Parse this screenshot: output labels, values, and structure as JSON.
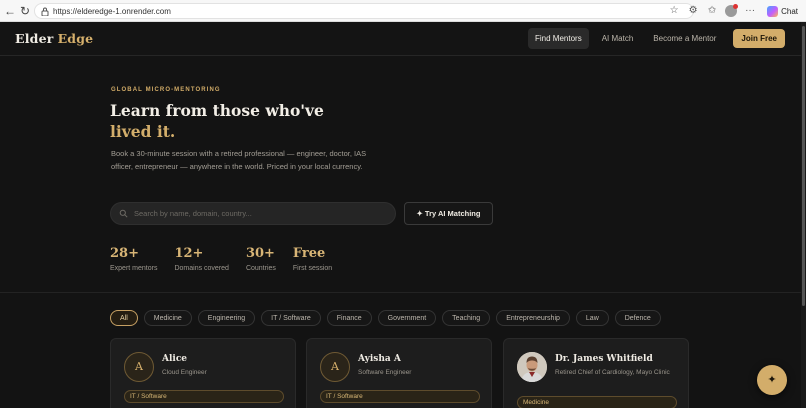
{
  "browser": {
    "url": "https://elderedge-1.onrender.com",
    "chat_label": "Chat"
  },
  "header": {
    "logo_word1": "Elder",
    "logo_word2": "Edge",
    "nav": [
      "Find Mentors",
      "AI Match",
      "Become a Mentor"
    ],
    "join_label": "Join Free"
  },
  "hero": {
    "eyebrow": "GLOBAL MICRO-MENTORING",
    "title_line1": "Learn from those who've",
    "title_line2": "lived it.",
    "subtitle": "Book a 30-minute session with a retired professional — engineer, doctor, IAS officer, entrepreneur — anywhere in the world. Priced in your local currency.",
    "search_placeholder": "Search by name, domain, country...",
    "ai_button": "✦ Try AI Matching"
  },
  "stats": [
    {
      "num": "28+",
      "label": "Expert mentors"
    },
    {
      "num": "12+",
      "label": "Domains covered"
    },
    {
      "num": "30+",
      "label": "Countries"
    },
    {
      "num": "Free",
      "label": "First session"
    }
  ],
  "filters": [
    "All",
    "Medicine",
    "Engineering",
    "IT / Software",
    "Finance",
    "Government",
    "Teaching",
    "Entrepreneurship",
    "Law",
    "Defence"
  ],
  "mentors": [
    {
      "initial": "A",
      "name": "Alice",
      "role": "Cloud Engineer",
      "tag": "IT / Software"
    },
    {
      "initial": "A",
      "name": "Ayisha A",
      "role": "Software Engineer",
      "tag": "IT / Software"
    },
    {
      "initial": "",
      "name": "Dr. James Whitfield",
      "role": "Retired Chief of Cardiology, Mayo Clinic",
      "tag": "Medicine"
    }
  ],
  "fab_icon": "✦",
  "colors": {
    "accent": "#d3ad6a",
    "background": "#131313"
  }
}
